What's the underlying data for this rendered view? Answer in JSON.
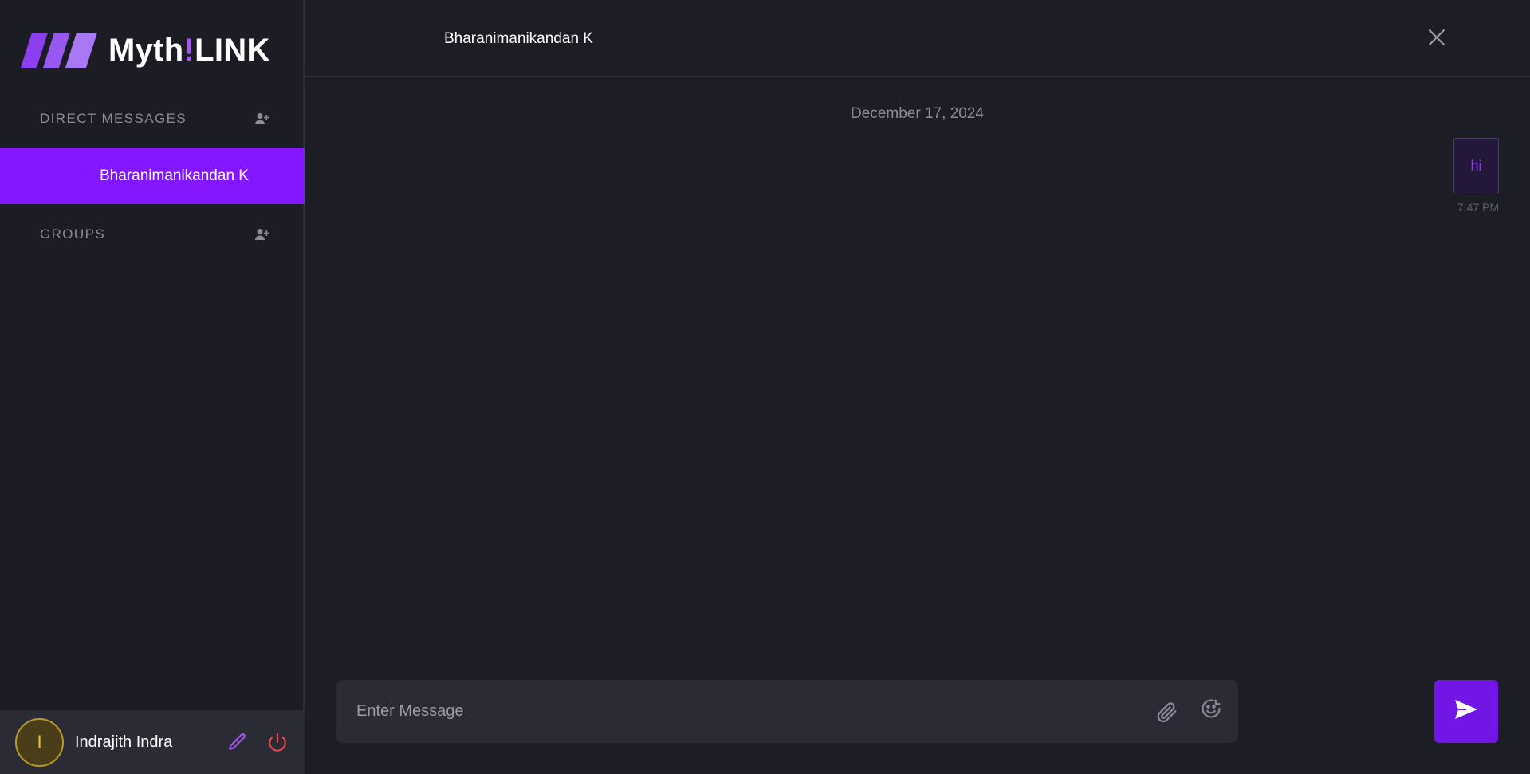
{
  "app": {
    "logo_text_main": "Myth",
    "logo_text_bang": "!",
    "logo_text_end": "LINK",
    "accent_color": "#8417ff"
  },
  "sidebar": {
    "direct_messages_title": "DIRECT MESSAGES",
    "direct_messages_icon": "add-user-icon",
    "contacts": [
      {
        "name": "Bharanimanikandan K",
        "active": true
      }
    ],
    "groups_title": "GROUPS",
    "groups_icon": "add-user-icon"
  },
  "profile": {
    "avatar_initial": "I",
    "name": "Indrajith Indra",
    "edit_icon": "pencil-icon",
    "logout_icon": "power-icon"
  },
  "chat": {
    "title": "Bharanimanikandan K",
    "close_icon": "close-icon",
    "date_separator": "December 17, 2024",
    "messages": [
      {
        "text": "hi",
        "time": "7:47 PM",
        "sent": true
      }
    ],
    "input_placeholder": "Enter Message",
    "attach_icon": "paperclip-icon",
    "emoji_icon": "emoji-icon",
    "send_icon": "send-icon"
  }
}
